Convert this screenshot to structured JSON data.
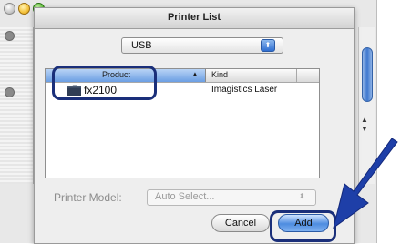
{
  "window": {
    "title": "Printer List"
  },
  "connection_popup": {
    "selected": "USB",
    "arrows": "⬍"
  },
  "printer_table": {
    "columns": [
      "Product",
      "Kind"
    ],
    "sort_indicator": "▲",
    "rows": [
      {
        "product": "fx2100",
        "kind": "Imagistics Laser",
        "icon": "folder-icon"
      }
    ]
  },
  "printer_model": {
    "label": "Printer Model:",
    "selected": "Auto Select...",
    "arrows": "⬍"
  },
  "buttons": {
    "cancel": "Cancel",
    "add": "Add"
  },
  "background_scroll": {
    "up_arrow": "▲",
    "down_arrow": "▼"
  },
  "colors": {
    "callout": "#1a2f7a",
    "arrow": "#1e3fa8",
    "selection_header": "#6b9ee3"
  }
}
